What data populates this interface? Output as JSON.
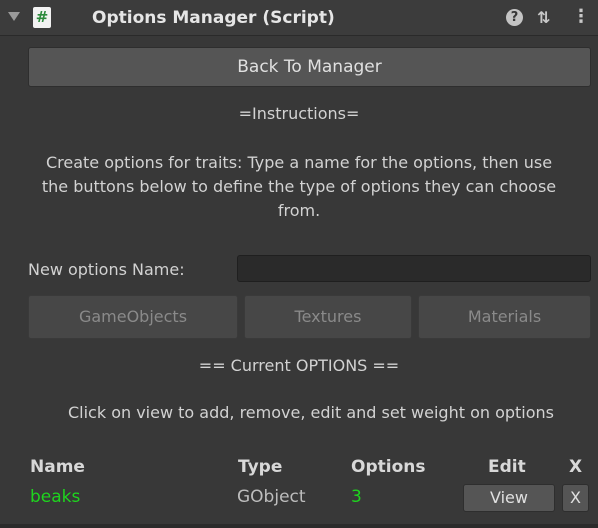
{
  "header": {
    "script_glyph": "#",
    "title": "Options Manager (Script)",
    "help_glyph": "?",
    "presets_glyph": "⇅",
    "menu_glyph": "⋮"
  },
  "back_button": "Back To Manager",
  "instructions_heading": "=Instructions=",
  "instructions_lines": [
    "Create options for traits: Type a name for the options, then use",
    "the buttons below to define the type of options they can choose",
    "from."
  ],
  "new_options": {
    "label": "New options Name:",
    "value": ""
  },
  "type_buttons": {
    "gameobjects": "GameObjects",
    "textures": "Textures",
    "materials": "Materials"
  },
  "current_heading": "== Current OPTIONS ==",
  "current_hint": "Click on view to add, remove, edit and set weight on options",
  "table": {
    "headers": {
      "name": "Name",
      "type": "Type",
      "options": "Options",
      "edit": "Edit",
      "delete": "X"
    },
    "rows": [
      {
        "name": "beaks",
        "type": "GObject",
        "options": "3",
        "view": "View",
        "delete": "X"
      }
    ]
  },
  "colors": {
    "background": "#383838",
    "highlight_green": "#1ed41e"
  }
}
